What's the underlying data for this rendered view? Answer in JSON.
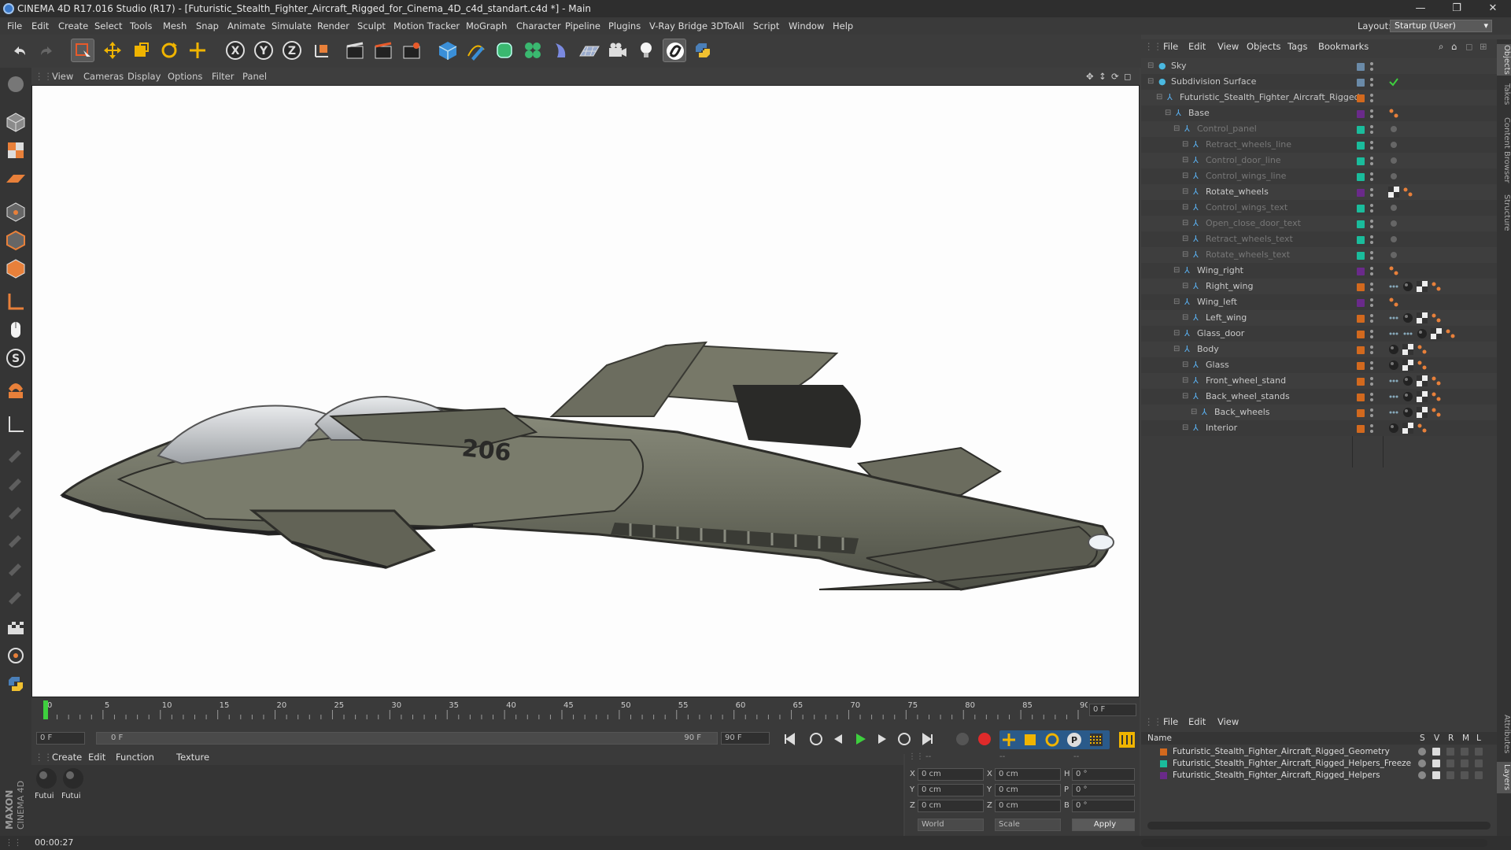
{
  "window": {
    "title": "CINEMA 4D R17.016 Studio (R17) - [Futuristic_Stealth_Fighter_Aircraft_Rigged_for_Cinema_4D_c4d_standart.c4d *] - Main",
    "minimize": "—",
    "maximize": "❐",
    "close": "✕"
  },
  "menubar": {
    "items": [
      "File",
      "Edit",
      "Create",
      "Select",
      "Tools",
      "Mesh",
      "Snap",
      "Animate",
      "Simulate",
      "Render",
      "Sculpt",
      "Motion Tracker",
      "MoGraph",
      "Character",
      "Pipeline",
      "Plugins",
      "V-Ray Bridge",
      "3DToAll",
      "Script",
      "Window",
      "Help"
    ],
    "layout_label": "Layout:",
    "layout_value": "Startup (User)"
  },
  "viewport": {
    "menu": [
      "View",
      "Cameras",
      "Display",
      "Options",
      "Filter",
      "Panel"
    ],
    "hull_number": "206"
  },
  "timeline": {
    "ticks": [
      "0",
      "5",
      "10",
      "15",
      "20",
      "25",
      "30",
      "35",
      "40",
      "45",
      "50",
      "55",
      "60",
      "65",
      "70",
      "75",
      "80",
      "85",
      "90"
    ],
    "current_frame_field": "0 F",
    "start_field": "0 F",
    "range_start": "0 F",
    "range_end": "90 F",
    "end_field": "90 F"
  },
  "materials": {
    "menu": [
      "Create",
      "Edit",
      "Function",
      "Texture"
    ],
    "items": [
      "Futui",
      "Futui"
    ]
  },
  "coordinates": {
    "header": [
      "--",
      "--",
      "--"
    ],
    "rows": [
      {
        "a": "X",
        "av": "0 cm",
        "b": "X",
        "bv": "0 cm",
        "c": "H",
        "cv": "0 °"
      },
      {
        "a": "Y",
        "av": "0 cm",
        "b": "Y",
        "bv": "0 cm",
        "c": "P",
        "cv": "0 °"
      },
      {
        "a": "Z",
        "av": "0 cm",
        "b": "Z",
        "bv": "0 cm",
        "c": "B",
        "cv": "0 °"
      }
    ],
    "mode": "World",
    "scale": "Scale",
    "apply": "Apply"
  },
  "status": {
    "time": "00:00:27"
  },
  "objects": {
    "menu": [
      "File",
      "Edit",
      "View",
      "Objects",
      "Tags",
      "Bookmarks"
    ],
    "rows": [
      {
        "name": "Sky",
        "indent": 0,
        "dim": false,
        "color": "#6a8aa8",
        "tags": []
      },
      {
        "name": "Subdivision Surface",
        "indent": 0,
        "dim": false,
        "color": "#6a8aa8",
        "tags": [
          "check"
        ]
      },
      {
        "name": "Futuristic_Stealth_Fighter_Aircraft_Rigged",
        "indent": 1,
        "dim": false,
        "color": "#d2691e",
        "tags": []
      },
      {
        "name": "Base",
        "indent": 2,
        "dim": false,
        "color": "#6a2a8a",
        "tags": [
          "orange"
        ]
      },
      {
        "name": "Control_panel",
        "indent": 3,
        "dim": true,
        "color": "#1abc9c",
        "tags": [
          "grey"
        ]
      },
      {
        "name": "Retract_wheels_line",
        "indent": 4,
        "dim": true,
        "color": "#1abc9c",
        "tags": [
          "grey"
        ]
      },
      {
        "name": "Control_door_line",
        "indent": 4,
        "dim": true,
        "color": "#1abc9c",
        "tags": [
          "grey"
        ]
      },
      {
        "name": "Control_wings_line",
        "indent": 4,
        "dim": true,
        "color": "#1abc9c",
        "tags": [
          "grey"
        ]
      },
      {
        "name": "Rotate_wheels",
        "indent": 4,
        "dim": false,
        "color": "#6a2a8a",
        "tags": [
          "checker",
          "orange"
        ]
      },
      {
        "name": "Control_wings_text",
        "indent": 4,
        "dim": true,
        "color": "#1abc9c",
        "tags": [
          "grey"
        ]
      },
      {
        "name": "Open_close_door_text",
        "indent": 4,
        "dim": true,
        "color": "#1abc9c",
        "tags": [
          "grey"
        ]
      },
      {
        "name": "Retract_wheels_text",
        "indent": 4,
        "dim": true,
        "color": "#1abc9c",
        "tags": [
          "grey"
        ]
      },
      {
        "name": "Rotate_wheels_text",
        "indent": 4,
        "dim": true,
        "color": "#1abc9c",
        "tags": [
          "grey"
        ]
      },
      {
        "name": "Wing_right",
        "indent": 3,
        "dim": false,
        "color": "#6a2a8a",
        "tags": [
          "orange"
        ]
      },
      {
        "name": "Right_wing",
        "indent": 4,
        "dim": false,
        "color": "#d2691e",
        "tags": [
          "dots",
          "sphere",
          "checker",
          "orange"
        ]
      },
      {
        "name": "Wing_left",
        "indent": 3,
        "dim": false,
        "color": "#6a2a8a",
        "tags": [
          "orange"
        ]
      },
      {
        "name": "Left_wing",
        "indent": 4,
        "dim": false,
        "color": "#d2691e",
        "tags": [
          "dots",
          "sphere",
          "checker",
          "orange"
        ]
      },
      {
        "name": "Glass_door",
        "indent": 3,
        "dim": false,
        "color": "#d2691e",
        "tags": [
          "dots",
          "dots",
          "sphere",
          "checker",
          "orange"
        ]
      },
      {
        "name": "Body",
        "indent": 3,
        "dim": false,
        "color": "#d2691e",
        "tags": [
          "sphere",
          "checker",
          "orange"
        ]
      },
      {
        "name": "Glass",
        "indent": 4,
        "dim": false,
        "color": "#d2691e",
        "tags": [
          "sphere",
          "checker",
          "orange"
        ]
      },
      {
        "name": "Front_wheel_stand",
        "indent": 4,
        "dim": false,
        "color": "#d2691e",
        "tags": [
          "dots",
          "sphere",
          "checker",
          "orange"
        ]
      },
      {
        "name": "Back_wheel_stands",
        "indent": 4,
        "dim": false,
        "color": "#d2691e",
        "tags": [
          "dots",
          "sphere",
          "checker",
          "orange"
        ]
      },
      {
        "name": "Back_wheels",
        "indent": 5,
        "dim": false,
        "color": "#d2691e",
        "tags": [
          "dots",
          "sphere",
          "checker",
          "orange"
        ]
      },
      {
        "name": "Interior",
        "indent": 4,
        "dim": false,
        "color": "#d2691e",
        "tags": [
          "sphere",
          "checker",
          "orange"
        ]
      }
    ]
  },
  "layers": {
    "menu": [
      "File",
      "Edit",
      "View"
    ],
    "header_name": "Name",
    "header_flags": [
      "S",
      "V",
      "R",
      "M",
      "L"
    ],
    "rows": [
      {
        "name": "Futuristic_Stealth_Fighter_Aircraft_Rigged_Geometry",
        "color": "#d2691e"
      },
      {
        "name": "Futuristic_Stealth_Fighter_Aircraft_Rigged_Helpers_Freeze",
        "color": "#1abc9c"
      },
      {
        "name": "Futuristic_Stealth_Fighter_Aircraft_Rigged_Helpers",
        "color": "#6a2a8a"
      }
    ]
  },
  "side_tabs": [
    "Objects",
    "Takes",
    "Content Browser",
    "Structure",
    "Attributes",
    "Layers"
  ],
  "brand": {
    "line1": "MAXON",
    "line2": "CINEMA 4D"
  }
}
